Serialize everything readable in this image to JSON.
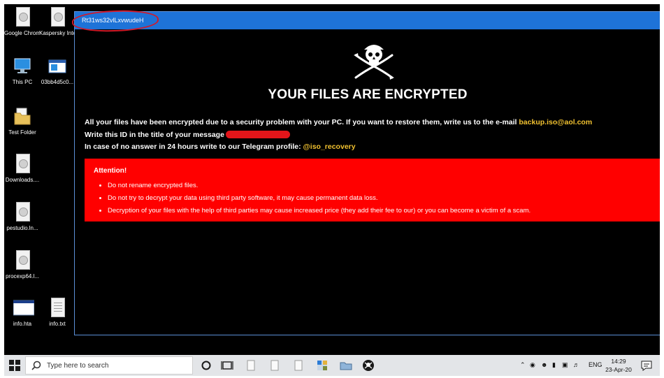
{
  "desktop_icons": [
    {
      "label": "Google Chrome.lnk...",
      "icon": "chrome-shortcut-icon"
    },
    {
      "label": "Kaspersky Internet Sec...",
      "icon": "kaspersky-shortcut-icon"
    },
    {
      "label": "This PC",
      "icon": "this-pc-icon"
    },
    {
      "label": "03bb4d5c0...",
      "icon": "executable-icon"
    },
    {
      "label": "Test Folder",
      "icon": "folder-icon"
    },
    {
      "label": "Downloads....",
      "icon": "downloads-shortcut-icon"
    },
    {
      "label": "pestudio.ln...",
      "icon": "pestudio-shortcut-icon"
    },
    {
      "label": "procexp64.l...",
      "icon": "procexp-shortcut-icon"
    },
    {
      "label": "info.hta",
      "icon": "hta-file-icon"
    },
    {
      "label": "info.txt",
      "icon": "text-file-icon"
    }
  ],
  "window": {
    "title": "Rt31ws32vlLxvwudeH",
    "headline": "YOUR FILES ARE ENCRYPTED",
    "message_line1": "All your files have been encrypted due to a security problem with your PC. If you want to restore them, write us to the e-mail",
    "email": "backup.iso@aol.com",
    "message_line2": "Write this ID in the title of your message",
    "message_line3": "In case of no answer in 24 hours write to our Telegram profile:",
    "telegram": "@iso_recovery",
    "attention_title": "Attention!",
    "attention_items": [
      "Do not rename encrypted files.",
      "Do not try to decrypt your data using third party software, it may cause permanent data loss.",
      "Decryption of your files with the help of third parties may cause increased price (they add their fee to our) or you can become a victim of a scam."
    ]
  },
  "taskbar": {
    "search_placeholder": "Type here to search",
    "language": "ENG",
    "time": "14:29",
    "date": "23-Apr-20"
  },
  "colors": {
    "titlebar": "#1e73d8",
    "attention_background": "#ff0000",
    "highlight_text": "#f2c230",
    "annotation_circle": "#d11a2a"
  }
}
